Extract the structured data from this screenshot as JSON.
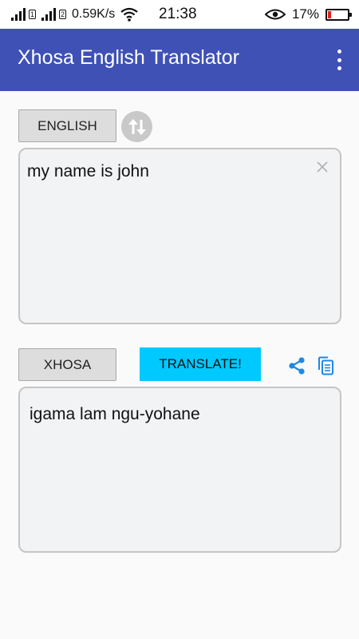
{
  "status_bar": {
    "sim1_label": "1",
    "sim2_label": "2",
    "net_speed": "0.59K/s",
    "time": "21:38",
    "battery_pct": "17%",
    "battery_level": 0.17,
    "battery_color": "#e0221f",
    "icons": [
      "signal-icon",
      "wifi-icon",
      "eye-icon",
      "battery-icon"
    ]
  },
  "app_bar": {
    "title": "Xhosa English Translator",
    "color": "#3f51b5",
    "menu_icon": "overflow-menu-icon"
  },
  "source": {
    "language": "ENGLISH",
    "input_text": "my name is john",
    "clear_icon": "close-icon",
    "swap_icon": "swap-languages-icon"
  },
  "target": {
    "language": "XHOSA",
    "translate_label": "TRANSLATE!",
    "translate_color": "#00c9ff",
    "output_text": "igama lam ngu-yohane",
    "share_icon": "share-icon",
    "copy_icon": "copy-icon"
  }
}
